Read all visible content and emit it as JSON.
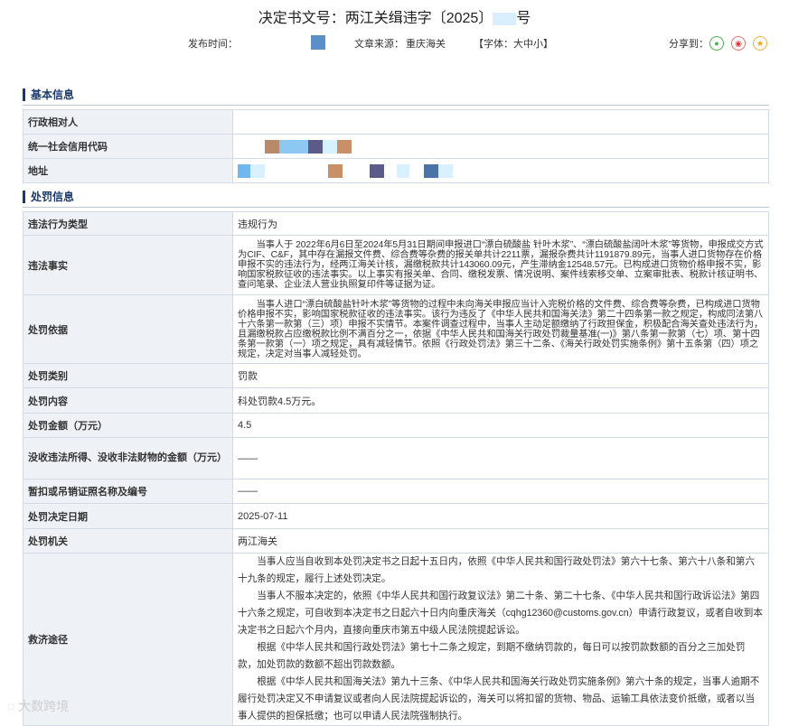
{
  "header": {
    "title": "决定书文号：两江关缉违字〔2025〕",
    "title_tail": "号",
    "publish_label": "发布时间：",
    "source_label": "文章来源：",
    "source_value": "重庆海关",
    "font_size_label": "【字体：大中小】",
    "share_label": "分享到：",
    "share_icons": [
      "wechat-icon",
      "weibo-icon",
      "qzone-icon"
    ]
  },
  "sections": {
    "basic": "基本信息",
    "penalty": "处罚信息"
  },
  "basic_info": [
    {
      "key": "行政相对人"
    },
    {
      "key": "统一社会信用代码"
    },
    {
      "key": "地址"
    }
  ],
  "penalty_info": {
    "violation_type": {
      "key": "违法行为类型",
      "value": "违规行为"
    },
    "facts": {
      "key": "违法事实",
      "value": "当事人于 2022年6月6日至2024年5月31日期间申报进口“漂白硫酸盐 针叶木浆”、“漂白硫酸盐阔叶木浆”等货物，申报成交方式为CIF、C&F，其中存在漏报文件费、综合费等杂费的报关单共计2211票，漏报杂费共计1191879.89元，当事人进口货物存在价格申报不实的违法行为，经两江海关计核，漏缴税款共计143060.09元，产生滞纳金12548.57元。已构成进口货物价格申报不实，影响国家税款征收的违法事实。以上事实有报关单、合同、缴税发票、情况说明、案件线索移交单、立案审批表、税款计核证明书、查问笔录、企业法人营业执照复印件等证据为证。"
    },
    "basis": {
      "key": "处罚依据",
      "value": "当事人进口“漂白硫酸盐针叶木浆”等货物的过程中未向海关申报应当计入完税价格的文件费、综合费等杂费，已构成进口货物价格申报不实，影响国家税款征收的违法事实。该行为违反了《中华人民共和国海关法》第二十四条第一款之规定，构成同法第八十六条第一款第（三）项）申报不实情节。本案件调查过程中，当事人主动足额缴纳了行政担保金，积极配合海关查处违法行为，且漏缴税款占应缴税款比例不满百分之一，依据《中华人民共和国海关行政处罚裁量基准(一)》第八条第一款第（七）项、第十四条第一款第（一）项之规定，具有减轻情节。依照《行政处罚法》第三十二条、《海关行政处罚实施条例》第十五条第（四）项之规定，决定对当事人减轻处罚。"
    },
    "category": {
      "key": "处罚类别",
      "value": "罚款"
    },
    "content": {
      "key": "处罚内容",
      "value": "科处罚款4.5万元。"
    },
    "amount": {
      "key": "处罚金额（万元）",
      "value": "4.5"
    },
    "confiscation": {
      "key": "没收违法所得、没收非法财物的金额（万元）",
      "value": "——"
    },
    "license": {
      "key": "暂扣或吊销证照名称及编号",
      "value": "——"
    },
    "date": {
      "key": "处罚决定日期",
      "value": "2025-07-11"
    },
    "authority": {
      "key": "处罚机关",
      "value": "两江海关"
    },
    "relief": {
      "key": "救济途径",
      "paragraphs": [
        "当事人应当自收到本处罚决定书之日起十五日内，依照《中华人民共和国行政处罚法》第六十七条、第六十八条和第六十九条的规定，履行上述处罚决定。",
        "当事人不服本决定的，依照《中华人民共和国行政复议法》第二十条、第二十七条、《中华人民共和国行政诉讼法》第四十六条之规定，可自收到本决定书之日起六十日内向重庆海关（cqhg12360@customs.gov.cn）申请行政复议，或者自收到本决定书之日起六个月内，直接向重庆市第五中级人民法院提起诉讼。",
        "根据《中华人民共和国行政处罚法》第七十二条之规定，到期不缴纳罚款的，每日可以按罚款数额的百分之三加处罚款，加处罚款的数额不超出罚款数额。",
        "根据《中华人民共和国海关法》第九十三条、《中华人民共和国海关行政处罚实施条例》第六十条的规定，当事人逾期不履行处罚决定又不申请复议或者向人民法院提起诉讼的，海关可以将扣留的货物、物品、运输工具依法变价抵缴，或者以当事人提供的担保抵缴；也可以申请人民法院强制执行。"
      ]
    }
  },
  "watermark": "大数跨境",
  "colors": {
    "section": "#1b3a6b",
    "key_bg": "#eef2f7",
    "border": "#d3dbe6"
  }
}
